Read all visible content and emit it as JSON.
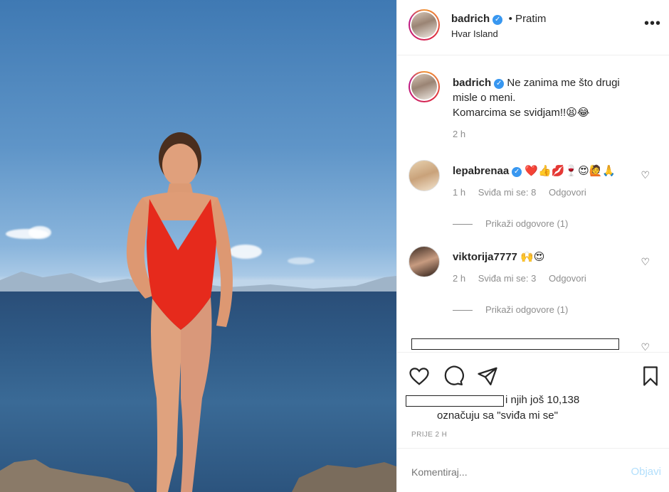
{
  "header": {
    "username": "badrich",
    "follow_label": "• Pratim",
    "location": "Hvar Island",
    "more_icon": "•••"
  },
  "caption": {
    "username": "badrich",
    "line1": "Ne zanima me što drugi",
    "line2": "misle o meni.",
    "line3": "Komarcima se svidjam!!😫😂",
    "time": "2 h"
  },
  "comments": [
    {
      "username": "lepabrenaa",
      "verified": true,
      "text": "❤️👍💋🍷😍🙋🙏",
      "time": "1 h",
      "likes": "Sviđa mi se: 8",
      "reply": "Odgovori",
      "show_replies": "Prikaži odgovore (1)"
    },
    {
      "username": "viktorija7777",
      "verified": false,
      "text": "🙌😍",
      "time": "2 h",
      "likes": "Sviđa mi se: 3",
      "reply": "Odgovori",
      "show_replies": "Prikaži odgovore (1)"
    }
  ],
  "likes_summary": {
    "line1": "i njih još 10,138",
    "line2": "označuju sa \"sviđa mi se\""
  },
  "timestamp": "PRIJE 2 H",
  "comment_input": {
    "placeholder": "Komentiraj...",
    "post_label": "Objavi"
  }
}
